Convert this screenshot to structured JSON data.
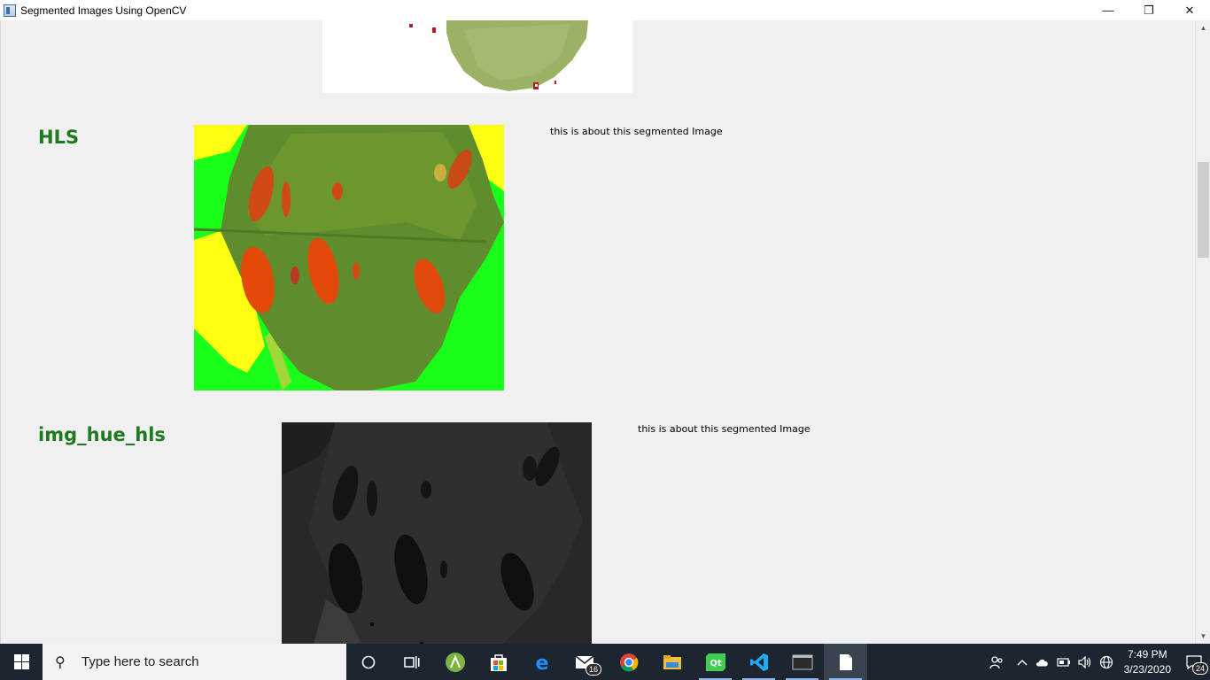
{
  "window": {
    "title": "Segmented Images Using OpenCV",
    "minimize": "—",
    "restore": "❐",
    "close": "✕"
  },
  "sections": [
    {
      "title": "HLS",
      "description": "this is about this segmented Image"
    },
    {
      "title": "img_hue_hls",
      "description": "this is about this segmented Image"
    }
  ],
  "taskbar": {
    "search_placeholder": "Type here to search",
    "icons": [
      "task-view-icon",
      "timeline-icon",
      "android-studio-icon",
      "store-icon",
      "edge-icon",
      "mail-icon",
      "chrome-icon",
      "file-explorer-icon",
      "qt-creator-icon",
      "vscode-icon",
      "terminal-icon",
      "document-icon"
    ],
    "mail_badge": "16",
    "clock_time": "7:49 PM",
    "clock_date": "3/23/2020",
    "notification_count": "24"
  },
  "colors": {
    "section_title": "#1f7a1f",
    "taskbar_bg": "#1c2530"
  }
}
